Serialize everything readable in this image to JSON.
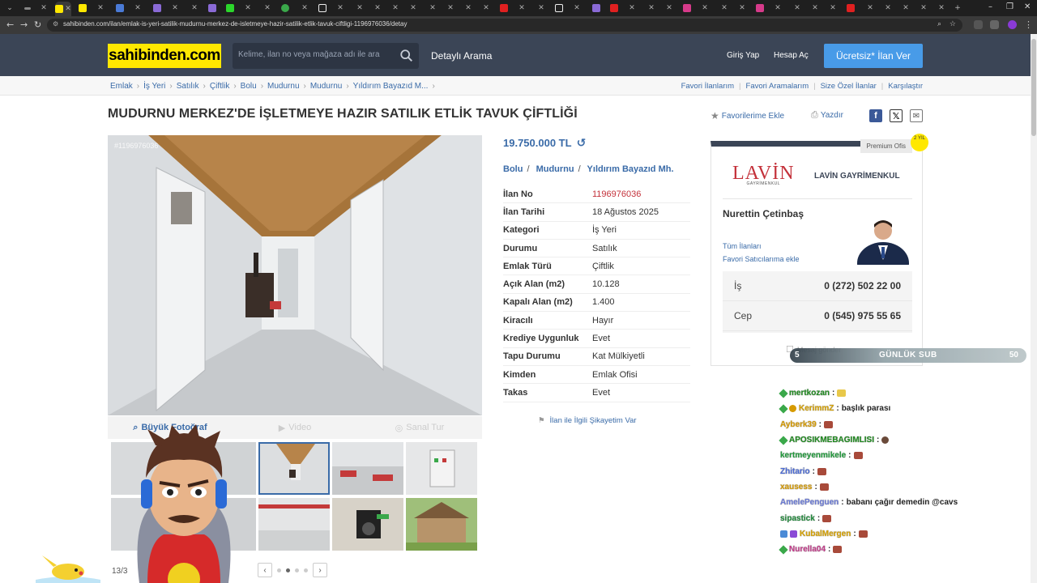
{
  "browser": {
    "url": "sahibinden.com/ilan/emlak-is-yeri-satilik-mudurnu-merkez-de-isletmeye-hazir-satilik-etlik-tavuk-ciftligi-1196976036/detay"
  },
  "header": {
    "logo": "sahibinden.com",
    "search_placeholder": "Kelime, ilan no veya mağaza adı ile ara",
    "advanced_search": "Detaylı Arama",
    "login": "Giriş Yap",
    "register": "Hesap Aç",
    "post_ad": "Ücretsiz* İlan Ver"
  },
  "breadcrumb": [
    "Emlak",
    "İş Yeri",
    "Satılık",
    "Çiftlik",
    "Bolu",
    "Mudurnu",
    "Mudurnu",
    "Yıldırım Bayazıd M..."
  ],
  "quick_links": [
    "Favori İlanlarım",
    "Favori Aramalarım",
    "Size Özel İlanlar",
    "Karşılaştır"
  ],
  "listing": {
    "title": "MUDURNU MERKEZ'DE İŞLETMEYE HAZIR SATILIK ETLİK TAVUK ÇİFTLİĞİ",
    "add_favorite": "Favorilerime Ekle",
    "print": "Yazdır",
    "watermark": "#1196976036",
    "price": "19.750.000 TL",
    "location": [
      "Bolu",
      "Mudurnu",
      "Yıldırım Bayazıd Mh."
    ],
    "photo_tabs": [
      "Büyük Fotoğraf",
      "Video",
      "Sanal Tur"
    ],
    "photo_counter": "13/3",
    "complaint": "İlan ile İlgili Şikayetim Var",
    "details": [
      {
        "key": "İlan No",
        "value": "1196976036"
      },
      {
        "key": "İlan Tarihi",
        "value": "18 Ağustos 2025"
      },
      {
        "key": "Kategori",
        "value": "İş Yeri"
      },
      {
        "key": "Durumu",
        "value": "Satılık"
      },
      {
        "key": "Emlak Türü",
        "value": "Çiftlik"
      },
      {
        "key": "Açık Alan (m2)",
        "value": "10.128"
      },
      {
        "key": "Kapalı Alan (m2)",
        "value": "1.400"
      },
      {
        "key": "Kiracılı",
        "value": "Hayır"
      },
      {
        "key": "Krediye Uygunluk",
        "value": "Evet"
      },
      {
        "key": "Tapu Durumu",
        "value": "Kat Mülkiyetli"
      },
      {
        "key": "Kimden",
        "value": "Emlak Ofisi"
      },
      {
        "key": "Takas",
        "value": "Evet"
      }
    ]
  },
  "seller": {
    "premium": "Premium Ofis",
    "badge": "2 YIL",
    "logo_text": "LAVİN",
    "logo_sub": "GAYRİMENKUL",
    "firm": "LAVİN GAYRİMENKUL",
    "name": "Nurettin Çetinbaş",
    "all_ads": "Tüm İlanları",
    "add_fav_seller": "Favori Satıcılarıma ekle",
    "phones": [
      {
        "label": "İş",
        "number": "0 (272) 502 22 00"
      },
      {
        "label": "Cep",
        "number": "0 (545) 975 55 65"
      }
    ],
    "message": "Mesaj gönder"
  },
  "overlay": {
    "sub_left": "5",
    "sub_label": "GÜNLÜK SUB",
    "sub_right": "50",
    "chat": [
      {
        "user": "mertkozan",
        "text": "",
        "color": "#1f8a1f"
      },
      {
        "user": "KerimmZ",
        "text": "başlık parası",
        "color": "#d6a100"
      },
      {
        "user": "Ayberk39",
        "text": "",
        "color": "#d69a00"
      },
      {
        "user": "APOSIKMEBAGIMLISI",
        "text": "",
        "color": "#1f8a1f"
      },
      {
        "user": "kertmeyenmikele",
        "text": "",
        "color": "#1f9a3a"
      },
      {
        "user": "Zhitario",
        "text": "",
        "color": "#4a6ad6"
      },
      {
        "user": "xausess",
        "text": "",
        "color": "#d69a00"
      },
      {
        "user": "AmelePenguen",
        "text": "babanı çağır demedin @cavs",
        "color": "#6a7ad6"
      },
      {
        "user": "sipastick",
        "text": "",
        "color": "#1f8a3a"
      },
      {
        "user": "KubalMergen",
        "text": "",
        "color": "#d6a100"
      },
      {
        "user": "Nurella04",
        "text": "",
        "color": "#c43a8a"
      }
    ]
  }
}
